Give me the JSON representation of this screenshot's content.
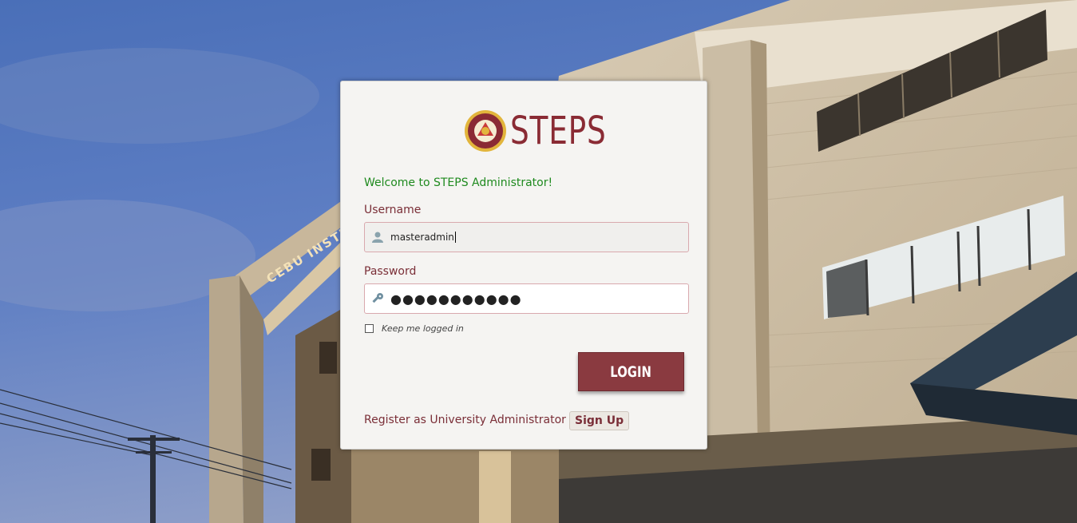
{
  "logo": {
    "text": "STEPS",
    "icon": "school-seal-icon"
  },
  "login": {
    "welcome": "Welcome to STEPS Administrator!",
    "username_label": "Username",
    "username_value": "masteradmin",
    "password_label": "Password",
    "password_value": "●●●●●●●●●●●",
    "remember_label": "Keep me logged in",
    "remember_checked": false,
    "login_button": "LOGIN",
    "register_text": "Register as University Administrator",
    "signup_button": "Sign Up"
  },
  "background": {
    "building_sign": "CEBU INSTI"
  },
  "colors": {
    "brand": "#8a2b34",
    "welcome_green": "#1f8a1f",
    "button": "#8a3a40"
  }
}
